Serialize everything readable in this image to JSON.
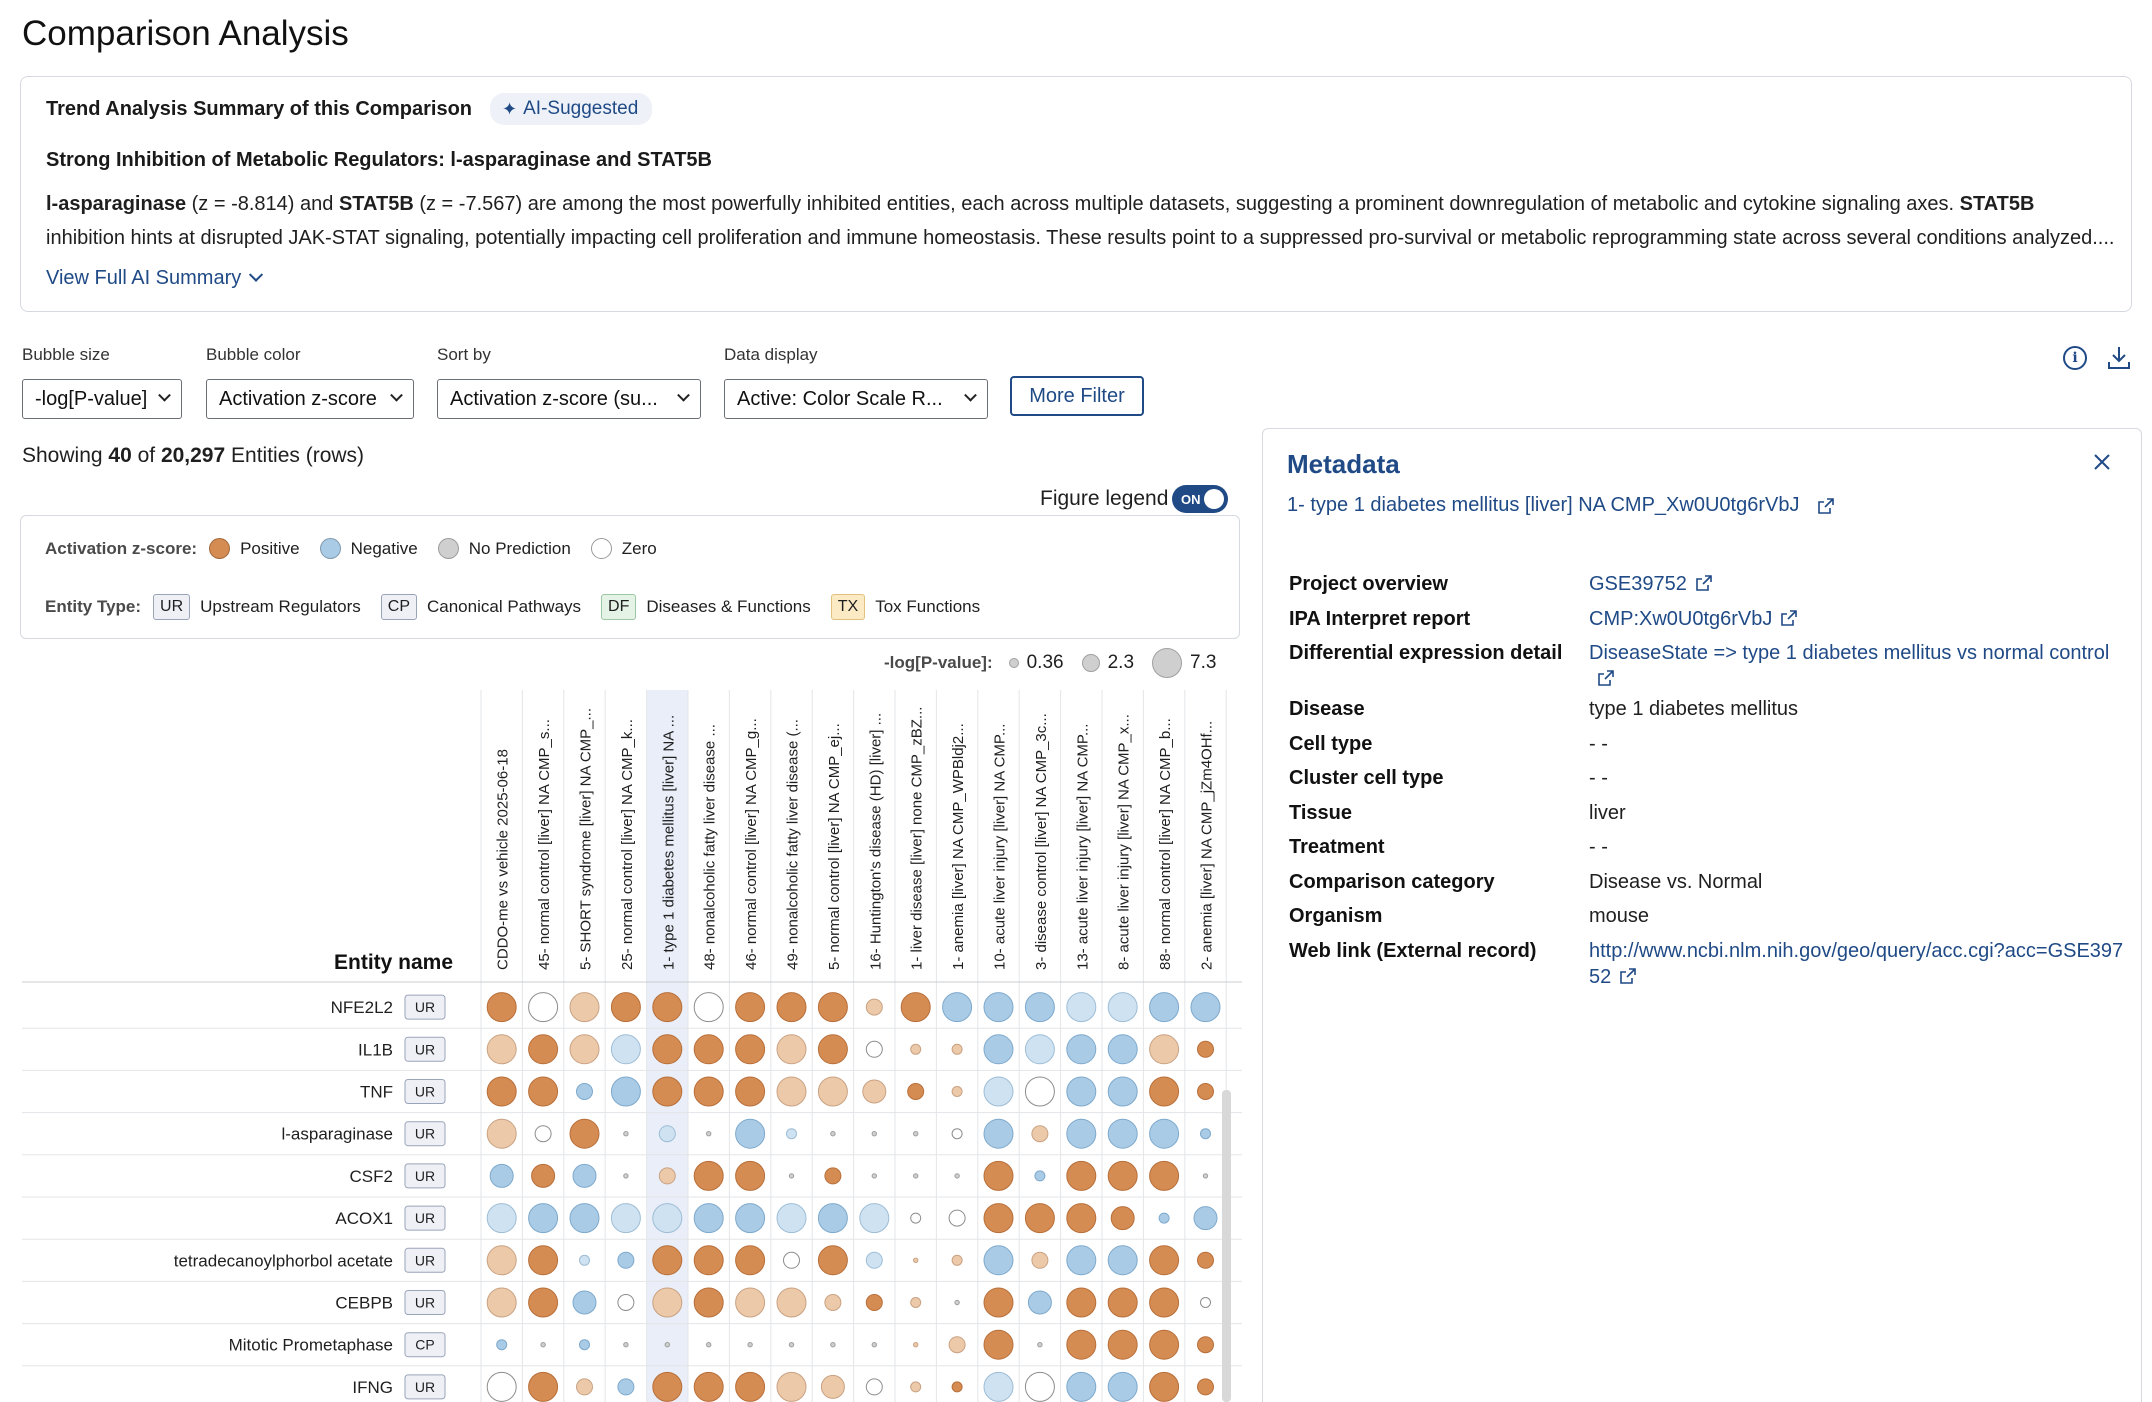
{
  "page": {
    "title": "Comparison Analysis"
  },
  "summary": {
    "heading": "Trend Analysis Summary of this Comparison",
    "badge": "AI-Suggested",
    "subtitle": "Strong Inhibition of Metabolic Regulators: l-asparaginase and STAT5B",
    "body_parts": [
      {
        "t": "l-asparaginase",
        "b": true
      },
      {
        "t": " (z = -8.814) and ",
        "b": false
      },
      {
        "t": "STAT5B",
        "b": true
      },
      {
        "t": " (z = -7.567) are among the most powerfully inhibited entities, each across multiple datasets, suggesting a prominent downregulation of metabolic and cytokine signaling axes. ",
        "b": false
      },
      {
        "t": "STAT5B",
        "b": true
      },
      {
        "t": " inhibition hints at disrupted JAK-STAT signaling, potentially impacting cell proliferation and immune homeostasis. These results point to a suppressed pro-survival or metabolic reprogramming state across several conditions analyzed....",
        "b": false
      }
    ],
    "view_full": "View Full AI Summary"
  },
  "controls": {
    "bubble_size": {
      "label": "Bubble size",
      "value": "-log[P-value]"
    },
    "bubble_color": {
      "label": "Bubble color",
      "value": "Activation z-score"
    },
    "sort_by": {
      "label": "Sort by",
      "value": "Activation z-score (su..."
    },
    "data_display": {
      "label": "Data display",
      "value": "Active: Color Scale R..."
    },
    "more_filter": "More Filter"
  },
  "showing": {
    "prefix": "Showing ",
    "shown": "40",
    "of": " of ",
    "total": "20,297",
    "suffix": " Entities (rows)"
  },
  "figure_legend": {
    "label": "Figure legend",
    "toggle": "ON"
  },
  "legend": {
    "activation_label": "Activation z-score:",
    "activation_items": [
      {
        "name": "Positive",
        "color": "#d58c52"
      },
      {
        "name": "Negative",
        "color": "#a9cbe6"
      },
      {
        "name": "No Prediction",
        "color": "#cfcfcf"
      },
      {
        "name": "Zero",
        "color": "#ffffff"
      }
    ],
    "entity_type_label": "Entity Type:",
    "entity_types": [
      {
        "code": "UR",
        "name": "Upstream Regulators"
      },
      {
        "code": "CP",
        "name": "Canonical Pathways"
      },
      {
        "code": "DF",
        "name": "Diseases & Functions"
      },
      {
        "code": "TX",
        "name": "Tox Functions"
      }
    ],
    "size_label": "-log[P-value]:",
    "size_values": [
      "0.36",
      "2.3",
      "7.3"
    ]
  },
  "metadata": {
    "title": "Metadata",
    "comparison": "1- type 1 diabetes mellitus [liver] NA CMP_Xw0U0tg6rVbJ",
    "rows": [
      {
        "key": "Project overview",
        "value": "GSE39752",
        "link": true
      },
      {
        "key": "IPA Interpret report",
        "value": "CMP:Xw0U0tg6rVbJ",
        "link": true
      },
      {
        "key": "Differential expression detail",
        "value": "DiseaseState => type 1 diabetes mellitus vs normal control",
        "link": true
      },
      {
        "key": "Disease",
        "value": "type 1 diabetes mellitus",
        "link": false
      },
      {
        "key": "Cell type",
        "value": "- -",
        "link": false
      },
      {
        "key": "Cluster cell type",
        "value": "- -",
        "link": false
      },
      {
        "key": "Tissue",
        "value": "liver",
        "link": false
      },
      {
        "key": "Treatment",
        "value": "- -",
        "link": false
      },
      {
        "key": "Comparison category",
        "value": "Disease vs. Normal",
        "link": false
      },
      {
        "key": "Organism",
        "value": "mouse",
        "link": false
      },
      {
        "key": "Web link (External record)",
        "value": "http://www.ncbi.nlm.nih.gov/geo/query/acc.cgi?acc=GSE39752",
        "link": true
      }
    ]
  },
  "grid": {
    "entity_header": "Entity name",
    "columns": [
      "CDDO-me vs vehicle 2025-06-18",
      "45- normal control [liver] NA CMP_s...",
      "5- SHORT syndrome [liver] NA CMP_...",
      "25- normal control [liver] NA CMP_k...",
      "1- type 1 diabetes mellitus [liver] NA ...",
      "48- nonalcoholic fatty liver disease ...",
      "46- normal control [liver] NA CMP_g...",
      "49- nonalcoholic fatty liver disease (...",
      "5- normal control [liver] NA CMP_ej...",
      "16- Huntington's disease (HD) [liver] ...",
      "1- liver disease [liver] none CMP_zBZ...",
      "1- anemia [liver] NA CMP_WPBldj2...",
      "10- acute liver injury [liver] NA CMP...",
      "3- disease control [liver] NA CMP_3c...",
      "13- acute liver injury [liver] NA CMP...",
      "8- acute liver injury [liver] NA CMP_x...",
      "88- normal control [liver] NA CMP_b...",
      "2- anemia [liver] NA CMP_jZm4OHf..."
    ],
    "highlight_col": 4,
    "rows": [
      {
        "name": "NFE2L2",
        "type": "UR",
        "cells": [
          "P4",
          "Z4",
          "p4",
          "P4",
          "P4",
          "Z4",
          "P4",
          "P4",
          "P4",
          "p2",
          "P4",
          "N4",
          "N4",
          "N4",
          "n4",
          "n4",
          "N4",
          "N4"
        ]
      },
      {
        "name": "IL1B",
        "type": "UR",
        "cells": [
          "p4",
          "P4",
          "p4",
          "n4",
          "P4",
          "P4",
          "P4",
          "p4",
          "P4",
          "Z2",
          "p1",
          "p1",
          "N4",
          "n4",
          "N4",
          "N4",
          "p4",
          "P2"
        ]
      },
      {
        "name": "TNF",
        "type": "UR",
        "cells": [
          "P4",
          "P4",
          "N2",
          "N4",
          "P4",
          "P4",
          "P4",
          "p4",
          "p4",
          "p3",
          "P2",
          "p1",
          "n4",
          "Z4",
          "N4",
          "N4",
          "P4",
          "P2"
        ]
      },
      {
        "name": "l-asparaginase",
        "type": "UR",
        "cells": [
          "p4",
          "Z2",
          "P4",
          "g0",
          "n2",
          "g0",
          "N4",
          "n1",
          "g0",
          "g0",
          "g0",
          "Z1",
          "N4",
          "p2",
          "N4",
          "N4",
          "N4",
          "N1"
        ]
      },
      {
        "name": "CSF2",
        "type": "UR",
        "cells": [
          "N3",
          "P3",
          "N3",
          "g0",
          "p2",
          "P4",
          "P4",
          "g0",
          "P2",
          "g0",
          "g0",
          "g0",
          "P4",
          "N1",
          "P4",
          "P4",
          "P4",
          "g0"
        ]
      },
      {
        "name": "ACOX1",
        "type": "UR",
        "cells": [
          "n4",
          "N4",
          "N4",
          "n4",
          "n4",
          "N4",
          "N4",
          "n4",
          "N4",
          "n4",
          "Z1",
          "Z2",
          "P4",
          "P4",
          "P4",
          "P3",
          "N1",
          "N3"
        ]
      },
      {
        "name": "tetradecanoylphorbol acetate",
        "type": "UR",
        "cells": [
          "p4",
          "P4",
          "n1",
          "N2",
          "P4",
          "P4",
          "P4",
          "Z2",
          "P4",
          "n2",
          "p0",
          "p1",
          "N4",
          "p2",
          "N4",
          "N4",
          "P4",
          "P2"
        ]
      },
      {
        "name": "CEBPB",
        "type": "UR",
        "cells": [
          "p4",
          "P4",
          "N3",
          "Z2",
          "p4",
          "P4",
          "p4",
          "p4",
          "p2",
          "P2",
          "p1",
          "g0",
          "P4",
          "N3",
          "P4",
          "P4",
          "P4",
          "Z1"
        ]
      },
      {
        "name": "Mitotic Prometaphase",
        "type": "CP",
        "cells": [
          "N1",
          "g0",
          "N1",
          "g0",
          "g0",
          "g0",
          "g0",
          "g0",
          "g0",
          "g0",
          "p0",
          "p2",
          "P4",
          "g0",
          "P4",
          "P4",
          "P4",
          "P2"
        ]
      },
      {
        "name": "IFNG",
        "type": "UR",
        "cells": [
          "Z4",
          "P4",
          "p2",
          "N2",
          "P4",
          "P4",
          "P4",
          "p4",
          "p3",
          "Z2",
          "p1",
          "P1",
          "n4",
          "Z4",
          "N4",
          "N4",
          "P4",
          "P2"
        ]
      }
    ]
  }
}
